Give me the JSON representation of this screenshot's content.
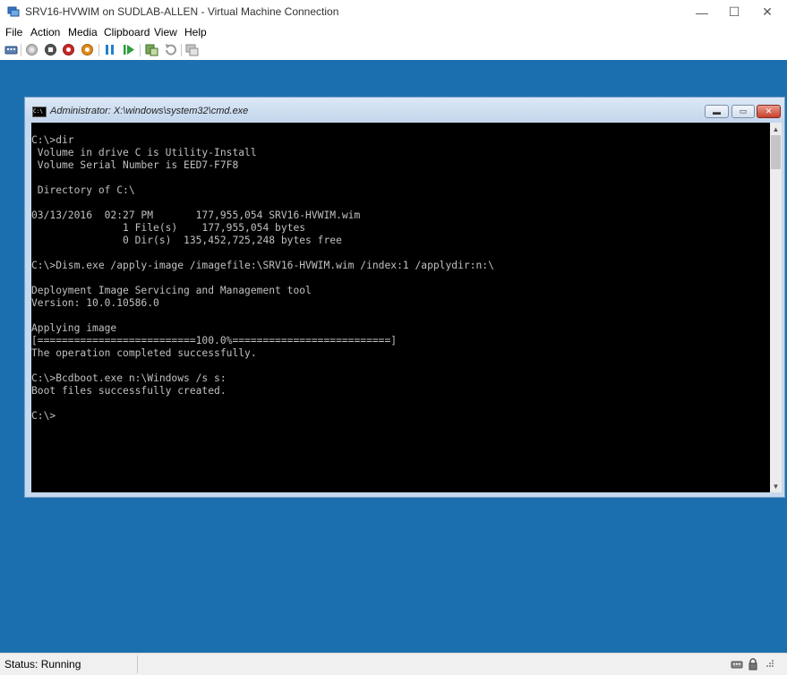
{
  "window": {
    "title": "SRV16-HVWIM on SUDLAB-ALLEN - Virtual Machine Connection",
    "minimize": "—",
    "maximize": "☐",
    "close": "✕"
  },
  "menu": [
    "File",
    "Action",
    "Media",
    "Clipboard",
    "View",
    "Help"
  ],
  "toolbar_icons": [
    "ctrl-alt-del-icon",
    "start-icon",
    "turn-off-icon",
    "shut-down-icon",
    "save-state-icon",
    "pause-icon",
    "resume-icon",
    "checkpoint-icon",
    "revert-icon",
    "enhanced-session-icon"
  ],
  "cmd": {
    "title": "Administrator: X:\\windows\\system32\\cmd.exe",
    "icon_text": "C:\\",
    "minimize": "▬",
    "maximize": "▭",
    "close": "✕",
    "lines": [
      "C:\\>dir",
      " Volume in drive C is Utility-Install",
      " Volume Serial Number is EED7-F7F8",
      "",
      " Directory of C:\\",
      "",
      "03/13/2016  02:27 PM       177,955,054 SRV16-HVWIM.wim",
      "               1 File(s)    177,955,054 bytes",
      "               0 Dir(s)  135,452,725,248 bytes free",
      "",
      "C:\\>Dism.exe /apply-image /imagefile:\\SRV16-HVWIM.wim /index:1 /applydir:n:\\",
      "",
      "Deployment Image Servicing and Management tool",
      "Version: 10.0.10586.0",
      "",
      "Applying image",
      "[==========================100.0%==========================]",
      "The operation completed successfully.",
      "",
      "C:\\>Bcdboot.exe n:\\Windows /s s:",
      "Boot files successfully created.",
      "",
      "C:\\>"
    ]
  },
  "status": {
    "label": "Status: Running"
  },
  "colors": {
    "desktop": "#1b6fae",
    "console_bg": "#000000",
    "console_text": "#c0c0c0"
  }
}
